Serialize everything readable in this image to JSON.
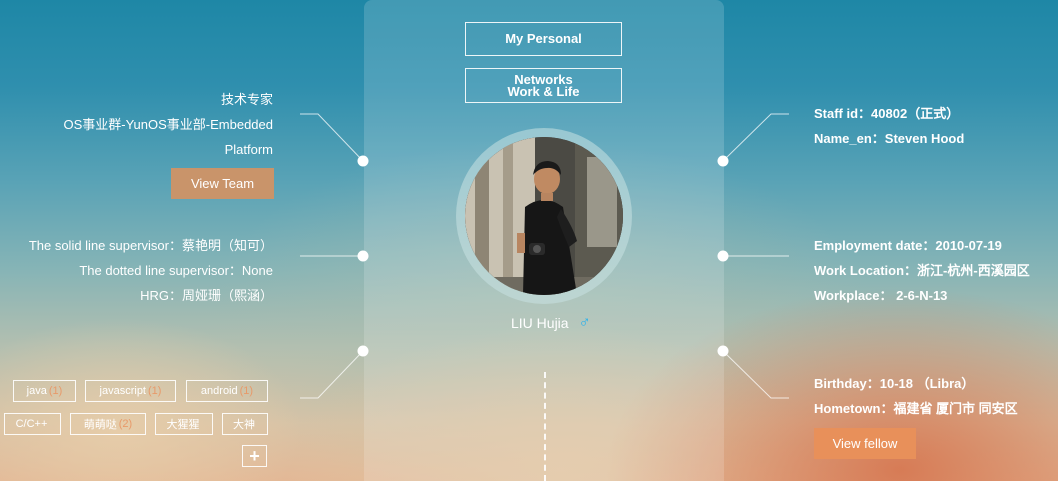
{
  "header": {
    "personal_label": "My Personal",
    "networks_label": "Networks\nWork & Life"
  },
  "profile": {
    "name": "LIU Hujia",
    "gender_symbol": "♂",
    "gender_color": "#1fb0f0"
  },
  "left": {
    "title_lines": [
      "技术专家",
      "OS事业群-YunOS事业部-Embedded",
      "Platform"
    ],
    "view_team_label": "View Team",
    "view_team_color": "#c9946a",
    "supervisors": [
      "The solid line supervisor：蔡艳明（知可）",
      "The dotted line supervisor：None",
      "HRG：周娅珊（熙涵）"
    ],
    "tags": [
      {
        "label": "java",
        "count": "(1)"
      },
      {
        "label": "javascript",
        "count": "(1)"
      },
      {
        "label": "android",
        "count": "(1)"
      },
      {
        "label": "C/C++",
        "count": ""
      },
      {
        "label": "萌萌哒",
        "count": "(2)"
      },
      {
        "label": "大猩猩",
        "count": ""
      },
      {
        "label": "大神",
        "count": ""
      }
    ],
    "add_tag_symbol": "+"
  },
  "right": {
    "ids": [
      "Staff id：40802（正式）",
      "Name_en：Steven Hood"
    ],
    "employment": [
      "Employment date：2010-07-19",
      "Work Location：浙江-杭州-西溪园区",
      "Workplace： 2-6-N-13"
    ],
    "personal": [
      "Birthday：10-18 （Libra）",
      "Hometown：福建省 厦门市 同安区"
    ],
    "view_fellow_label": "View fellow",
    "view_fellow_color": "#e8905a"
  }
}
